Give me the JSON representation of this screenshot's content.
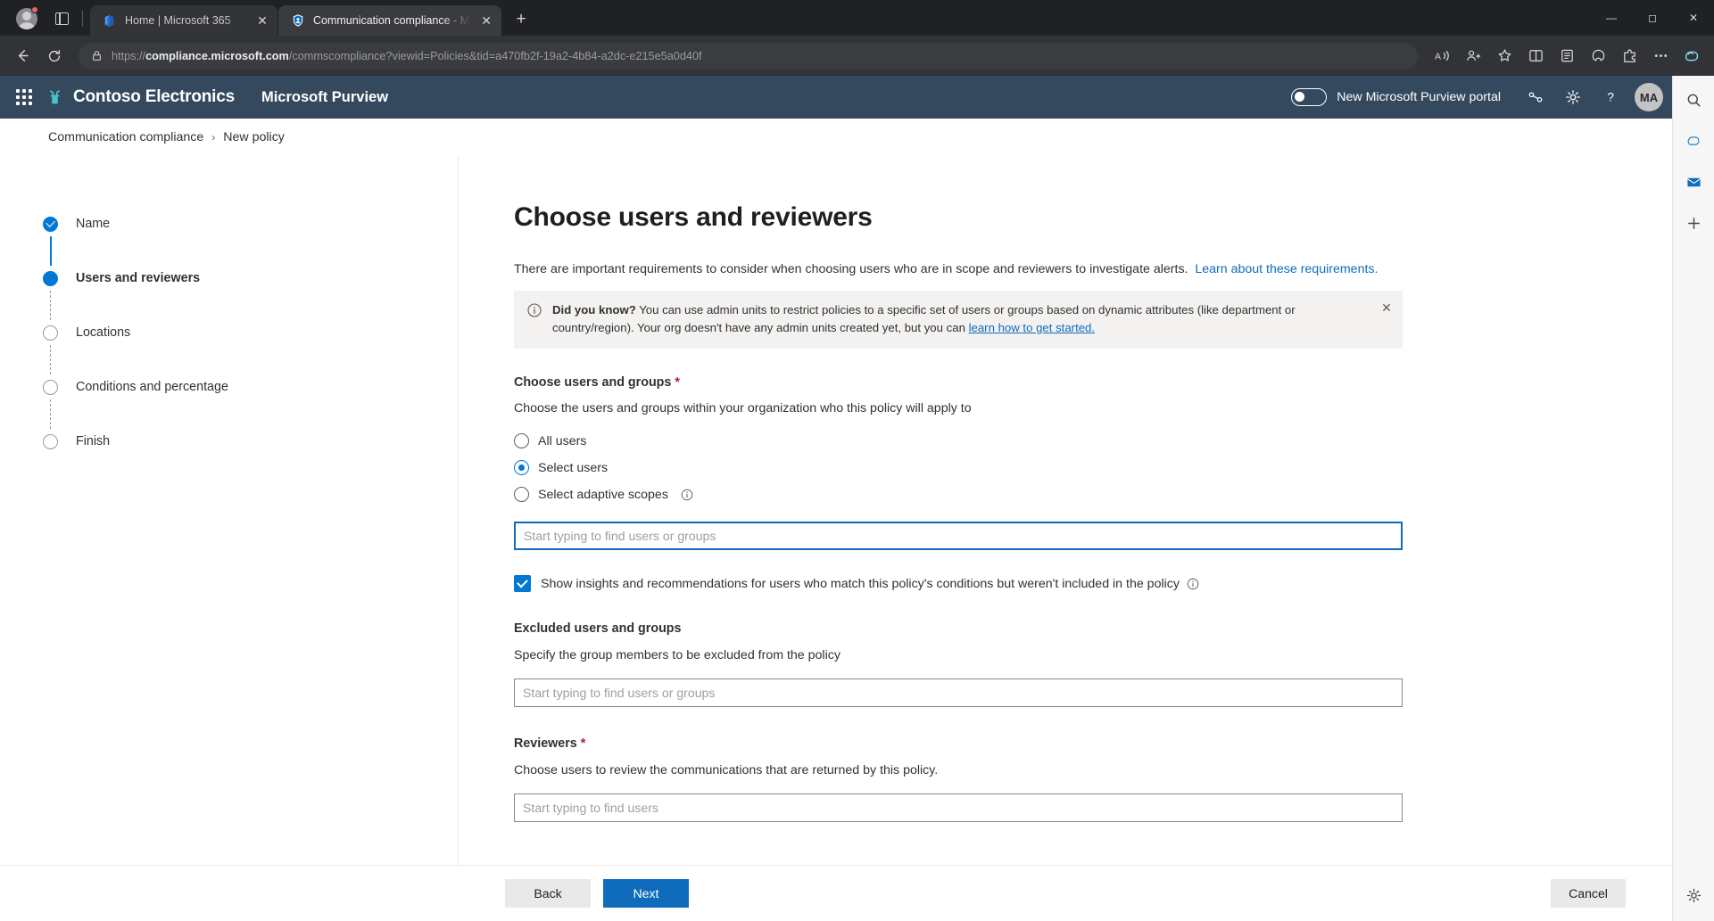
{
  "browser": {
    "tabs": [
      {
        "title": "Home | Microsoft 365",
        "favicon": "microsoft-365-icon",
        "active": false
      },
      {
        "title": "Communication compliance - Mi",
        "favicon": "purview-shield-icon",
        "active": true
      }
    ],
    "newtab_label": "+",
    "window_controls": {
      "minimize": "—",
      "maximize": "☐",
      "close": "✕"
    },
    "nav": {
      "back": "back-arrow",
      "refresh": "refresh-arrow",
      "lock": "lock-icon"
    },
    "url": {
      "scheme": "https://",
      "domain": "compliance.microsoft.com",
      "path": "/commscompliance?viewid=Policies&tid=a470fb2f-19a2-4b84-a2dc-e215e5a0d40f",
      "full": "https://compliance.microsoft.com/commscompliance?viewid=Policies&tid=a470fb2f-19a2-4b84-a2dc-e215e5a0d40f"
    },
    "toolbar_icons": [
      "read-aloud-icon",
      "profile-split-icon",
      "favorite-star-icon",
      "split-screen-icon",
      "collections-icon",
      "browser-essentials-icon",
      "extensions-icon",
      "settings-more-icon",
      "copilot-icon"
    ],
    "sidebar_icons": [
      "search-icon",
      "copilot-icon",
      "outlook-icon",
      "add-icon",
      "settings-gear-icon"
    ]
  },
  "suite_header": {
    "waffle": "app-launcher-icon",
    "brand": "Contoso Electronics",
    "app_name": "Microsoft Purview",
    "toggle_label": "New Microsoft Purview portal",
    "toggle_on": false,
    "icons": [
      "diagnostics-icon",
      "settings-gear-icon",
      "help-icon"
    ],
    "avatar_initials": "MA",
    "search_icon": "search-icon",
    "accent_color": "#34495e"
  },
  "breadcrumb": {
    "items": [
      "Communication compliance",
      "New policy"
    ],
    "separator": "›"
  },
  "wizard": {
    "steps": [
      {
        "label": "Name",
        "state": "done"
      },
      {
        "label": "Users and reviewers",
        "state": "current"
      },
      {
        "label": "Locations",
        "state": "todo"
      },
      {
        "label": "Conditions and percentage",
        "state": "todo"
      },
      {
        "label": "Finish",
        "state": "todo"
      }
    ]
  },
  "main": {
    "title": "Choose users and reviewers",
    "intro_text": "There are important requirements to consider when choosing users who are in scope and reviewers to investigate alerts.",
    "intro_link": "Learn about these requirements.",
    "info_banner": {
      "icon": "info-circle-icon",
      "bold_lead": "Did you know?",
      "body": " You can use admin units to restrict policies to a specific set of users or groups based on dynamic attributes (like department or country/region). Your org doesn't have any admin units created yet, but you can ",
      "link": "learn how to get started.",
      "close_icon": "close-icon"
    },
    "choose_users": {
      "label": "Choose users and groups",
      "required_mark": "*",
      "description": "Choose the users and groups within your organization who this policy will apply to",
      "options": [
        {
          "label": "All users",
          "selected": false,
          "has_info": false
        },
        {
          "label": "Select users",
          "selected": true,
          "has_info": false
        },
        {
          "label": "Select adaptive scopes",
          "selected": false,
          "has_info": true
        }
      ],
      "picker_placeholder": "Start typing to find users or groups",
      "picker_value": "",
      "picker_focused": true
    },
    "insights_checkbox": {
      "checked": true,
      "label": "Show insights and recommendations for users who match this policy's conditions but weren't included in the policy",
      "has_info": true
    },
    "excluded": {
      "label": "Excluded users and groups",
      "description": "Specify the group members to be excluded from the policy",
      "placeholder": "Start typing to find users or groups",
      "value": ""
    },
    "reviewers": {
      "label": "Reviewers",
      "required_mark": "*",
      "description": "Choose users to review the communications that are returned by this policy.",
      "placeholder": "Start typing to find users",
      "value": ""
    }
  },
  "footer": {
    "back": "Back",
    "next": "Next",
    "cancel": "Cancel",
    "primary_color": "#0f6cbd"
  }
}
